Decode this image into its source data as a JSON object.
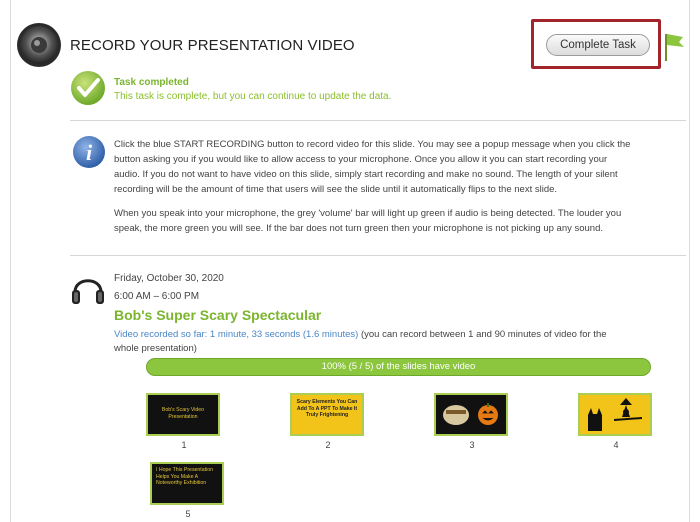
{
  "header": {
    "title": "RECORD YOUR PRESENTATION VIDEO",
    "complete_button": "Complete Task",
    "icon": "speaker-icon"
  },
  "status": {
    "title": "Task completed",
    "text": "This task is complete, but you can continue to update the data.",
    "icon": "checkmark-icon"
  },
  "info": {
    "icon": "info-icon",
    "paragraph1_lines": [
      "Click the blue START RECORDING button to record video for this slide. You may see a popup message when you click the",
      "button asking you if you would like to allow access to your microphone. Once you allow it you can start recording your",
      "audio. If you do not want to have video on this slide, simply start recording and make no sound. The length of your silent",
      "recording will be the amount of time that users will see the slide until it automatically flips to the next slide."
    ],
    "paragraph2_lines": [
      "When you speak into your microphone, the grey 'volume' bar will light up green if audio is being detected. The louder you",
      "speak, the more green you will see. If the bar does not turn green then your microphone is not picking up any sound."
    ]
  },
  "event": {
    "icon": "headphones-icon",
    "date": "Friday, October 30, 2020",
    "time": "6:00 AM – 6:00 PM",
    "title": "Bob's Super Scary Spectacular",
    "recorded_prefix": "Video recorded so far: 1 minute, 33 seconds (1.6 minutes)",
    "recorded_suffix_line1": " (you can record between 1 and 90 minutes of video for the",
    "recorded_suffix_line2": "whole presentation)"
  },
  "progress": {
    "label": "100% (5 / 5) of the slides have video",
    "fraction": 1.0
  },
  "slides": [
    {
      "number": "1",
      "text": "Bob's Scary Video Presentation"
    },
    {
      "number": "2",
      "text": "Scary Elements You Can Add To A PPT To Make It Truly Frightening"
    },
    {
      "number": "3",
      "text": ""
    },
    {
      "number": "4",
      "text": ""
    },
    {
      "number": "5",
      "text": "I Hope This Presentation Helps You Make A Noteworthy Exhibition"
    }
  ],
  "colors": {
    "accent_green": "#7bb52e",
    "link_blue": "#4a86c8",
    "highlight_red": "#a3242a",
    "slide_yellow": "#f2c318"
  }
}
